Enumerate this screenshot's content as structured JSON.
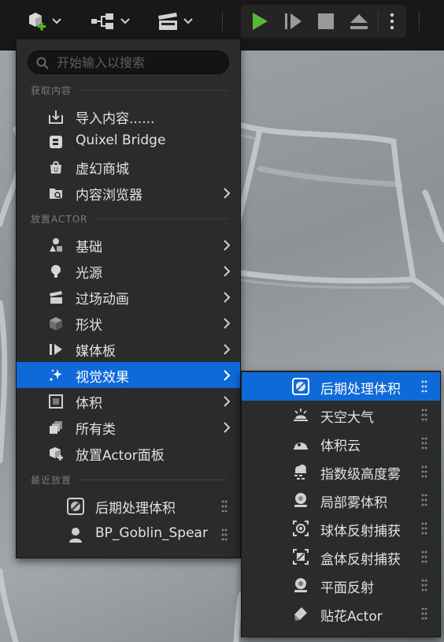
{
  "toolbar": {
    "buttons": [
      {
        "name": "add-content-button",
        "icon": "cube-plus-icon"
      },
      {
        "name": "blueprints-button",
        "icon": "blueprint-nodes-icon"
      },
      {
        "name": "cinematics-button",
        "icon": "clapperboard-icon"
      }
    ],
    "play_controls": [
      "play-icon",
      "step-forward-icon",
      "stop-icon",
      "eject-icon",
      "more-options-icon"
    ],
    "colors": {
      "play": "#58b83a",
      "accent": "#0e6ad8"
    }
  },
  "menu": {
    "search": {
      "placeholder": "开始输入以搜索",
      "value": ""
    },
    "sections": {
      "get_content": "获取内容",
      "place_actor": "放置ACTOR",
      "recent": "最近放置"
    },
    "get_content_items": [
      {
        "label": "导入内容......",
        "icon": "import-icon",
        "submenu": false
      },
      {
        "label": "Quixel Bridge",
        "icon": "bridge-icon",
        "submenu": false
      },
      {
        "label": "虚幻商城",
        "icon": "marketplace-icon",
        "submenu": false
      },
      {
        "label": "内容浏览器",
        "icon": "content-browser-icon",
        "submenu": true
      }
    ],
    "place_actor_items": [
      {
        "label": "基础",
        "icon": "basic-shapes-icon",
        "submenu": true
      },
      {
        "label": "光源",
        "icon": "light-bulb-icon",
        "submenu": true
      },
      {
        "label": "过场动画",
        "icon": "clapperboard-icon",
        "submenu": true
      },
      {
        "label": "形状",
        "icon": "cube-icon",
        "submenu": true
      },
      {
        "label": "媒体板",
        "icon": "media-icon",
        "submenu": true
      },
      {
        "label": "视觉效果",
        "icon": "sparkle-icon",
        "submenu": true,
        "active": true
      },
      {
        "label": "体积",
        "icon": "volume-icon",
        "submenu": true
      },
      {
        "label": "所有类",
        "icon": "all-classes-icon",
        "submenu": true
      },
      {
        "label": "放置Actor面板",
        "icon": "place-actor-icon",
        "submenu": false
      }
    ],
    "recent_items": [
      {
        "label": "后期处理体积",
        "icon": "post-process-icon"
      },
      {
        "label": "BP_Goblin_Spear",
        "icon": "character-icon"
      }
    ]
  },
  "submenu": {
    "items": [
      {
        "label": "后期处理体积",
        "icon": "post-process-icon",
        "active": true
      },
      {
        "label": "天空大气",
        "icon": "sky-atmosphere-icon"
      },
      {
        "label": "体积云",
        "icon": "volumetric-cloud-icon"
      },
      {
        "label": "指数级高度雾",
        "icon": "height-fog-icon"
      },
      {
        "label": "局部雾体积",
        "icon": "local-fog-icon"
      },
      {
        "label": "球体反射捕获",
        "icon": "sphere-reflection-icon"
      },
      {
        "label": "盒体反射捕获",
        "icon": "box-reflection-icon"
      },
      {
        "label": "平面反射",
        "icon": "planar-reflection-icon"
      },
      {
        "label": "贴花Actor",
        "icon": "decal-icon"
      }
    ]
  }
}
